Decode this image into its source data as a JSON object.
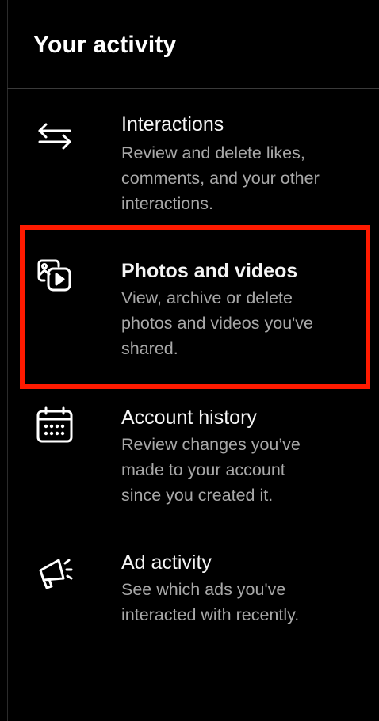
{
  "header": {
    "title": "Your activity"
  },
  "items": [
    {
      "icon": "interactions-arrows-icon",
      "title": "Interactions",
      "desc_lines": [
        "Review and delete likes,",
        "comments, and your other",
        "interactions."
      ]
    },
    {
      "icon": "photos-videos-icon",
      "title": "Photos and videos",
      "desc_lines": [
        "View, archive or delete",
        "photos and videos you've",
        "shared."
      ],
      "highlighted": true
    },
    {
      "icon": "calendar-icon",
      "title": "Account history",
      "desc_lines": [
        "Review changes you’ve",
        "made to your account",
        "since you created it."
      ]
    },
    {
      "icon": "megaphone-icon",
      "title": "Ad activity",
      "desc_lines": [
        "See which ads you've",
        "interacted with recently."
      ]
    }
  ],
  "colors": {
    "background": "#000000",
    "text_primary": "#ffffff",
    "text_secondary": "#a8a8a8",
    "highlight": "#ff1a00"
  }
}
